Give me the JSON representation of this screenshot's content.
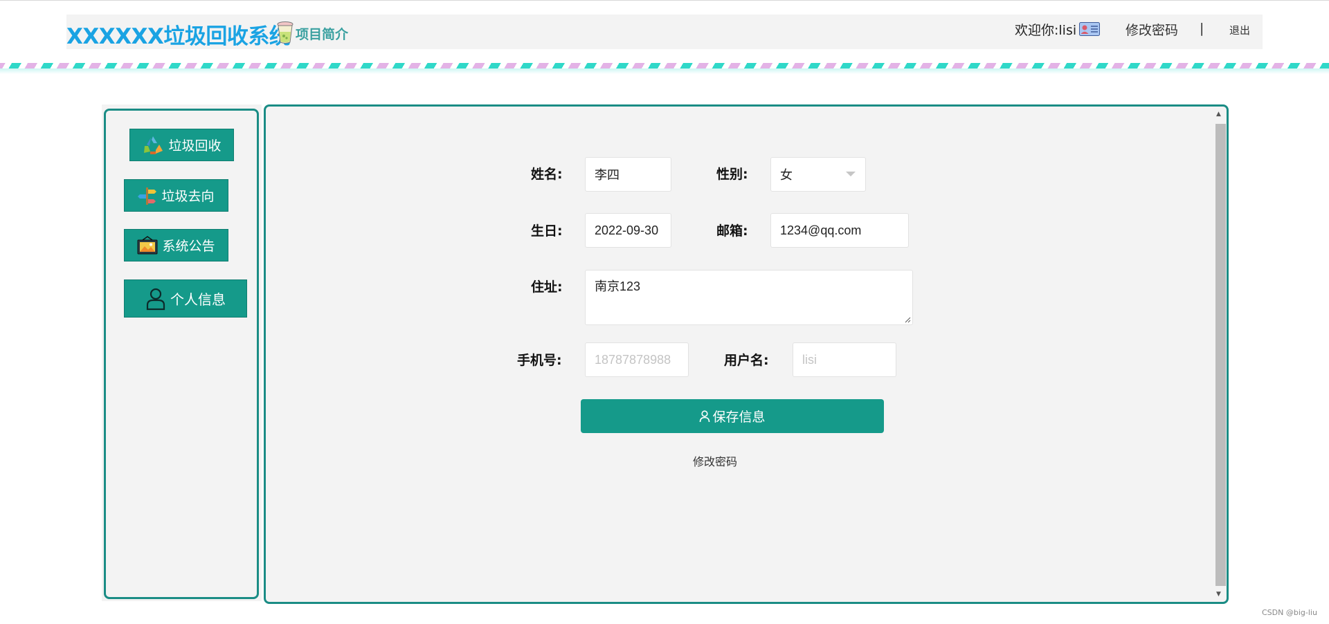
{
  "header": {
    "app_title": "XXXXXX垃圾回收系统",
    "intro_link": "项目简介",
    "welcome_prefix": "欢迎你:",
    "username": "lisi",
    "change_password": "修改密码",
    "separator": "|",
    "logout": "退出"
  },
  "sidebar": {
    "items": [
      {
        "label": "垃圾回收",
        "icon": "recycle-icon"
      },
      {
        "label": "垃圾去向",
        "icon": "signpost-icon"
      },
      {
        "label": "系统公告",
        "icon": "notice-board-icon"
      },
      {
        "label": "个人信息",
        "icon": "user-icon"
      }
    ]
  },
  "form": {
    "name_label": "姓名:",
    "name_value": "李四",
    "gender_label": "性别:",
    "gender_value": "女",
    "birthday_label": "生日:",
    "birthday_value": "2022-09-30",
    "email_label": "邮箱:",
    "email_value": "1234@qq.com",
    "address_label": "住址:",
    "address_value": "南京123",
    "phone_label": "手机号:",
    "phone_placeholder": "18787878988",
    "username_label": "用户名:",
    "username_placeholder": "lisi",
    "save_button": "保存信息",
    "change_password_link": "修改密码"
  },
  "watermark": "CSDN @big-liu",
  "colors": {
    "accent": "#159a8a",
    "border": "#1a8c85",
    "title_blue": "#1aa3e3",
    "panel_bg": "#f3f3f3"
  }
}
